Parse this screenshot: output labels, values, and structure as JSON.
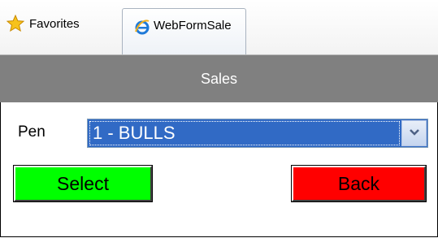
{
  "browser": {
    "favorites_label": "Favorites",
    "tab_title": "WebFormSale"
  },
  "header": {
    "title": "Sales"
  },
  "form": {
    "pen_label": "Pen",
    "pen_selected": "1 - BULLS"
  },
  "buttons": {
    "select_label": "Select",
    "back_label": "Back"
  },
  "colors": {
    "header_bg": "#808080",
    "select_button": "#00ff00",
    "back_button": "#ff0000",
    "dropdown_highlight": "#316ac5"
  }
}
